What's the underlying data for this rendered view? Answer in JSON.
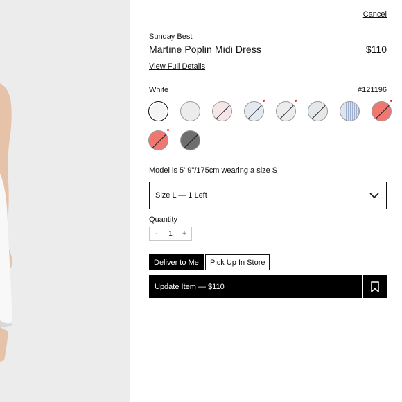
{
  "header": {
    "cancel_label": "Cancel"
  },
  "product": {
    "brand": "Sunday Best",
    "name": "Martine Poplin Midi Dress",
    "price": "$110",
    "details_link": "View Full Details"
  },
  "color": {
    "selected_name": "White",
    "sku": "#121196",
    "swatches": [
      {
        "color": "#f4f4f4",
        "selected": true,
        "unavailable": false,
        "dot": false
      },
      {
        "color": "#ebecec",
        "selected": false,
        "unavailable": false,
        "dot": false
      },
      {
        "color": "#f6e6e8",
        "selected": false,
        "unavailable": true,
        "dot": false
      },
      {
        "color": "#e4e8f0",
        "selected": false,
        "unavailable": true,
        "dot": true
      },
      {
        "color": "#ececee",
        "selected": false,
        "unavailable": true,
        "dot": true
      },
      {
        "color": "#e5e8ea",
        "selected": false,
        "unavailable": true,
        "dot": false
      },
      {
        "color": "#dde4ee",
        "selected": false,
        "unavailable": false,
        "dot": false,
        "pattern": "stripes"
      },
      {
        "color": "#f07670",
        "selected": false,
        "unavailable": true,
        "dot": true
      },
      {
        "color": "#f07670",
        "selected": false,
        "unavailable": true,
        "dot": true
      },
      {
        "color": "#6e6e6e",
        "selected": false,
        "unavailable": true,
        "dot": false
      }
    ]
  },
  "model_info": "Model is 5' 9\"/175cm wearing a size S",
  "size": {
    "selected": "Size L — 1 Left",
    "icon": "chevron-down-icon"
  },
  "quantity": {
    "label": "Quantity",
    "minus": "-",
    "value": "1",
    "plus": "+"
  },
  "fulfillment": {
    "deliver_label": "Deliver to Me",
    "pickup_label": "Pick Up In Store"
  },
  "actions": {
    "update_label": "Update Item — $110",
    "bookmark_icon": "bookmark-icon"
  }
}
